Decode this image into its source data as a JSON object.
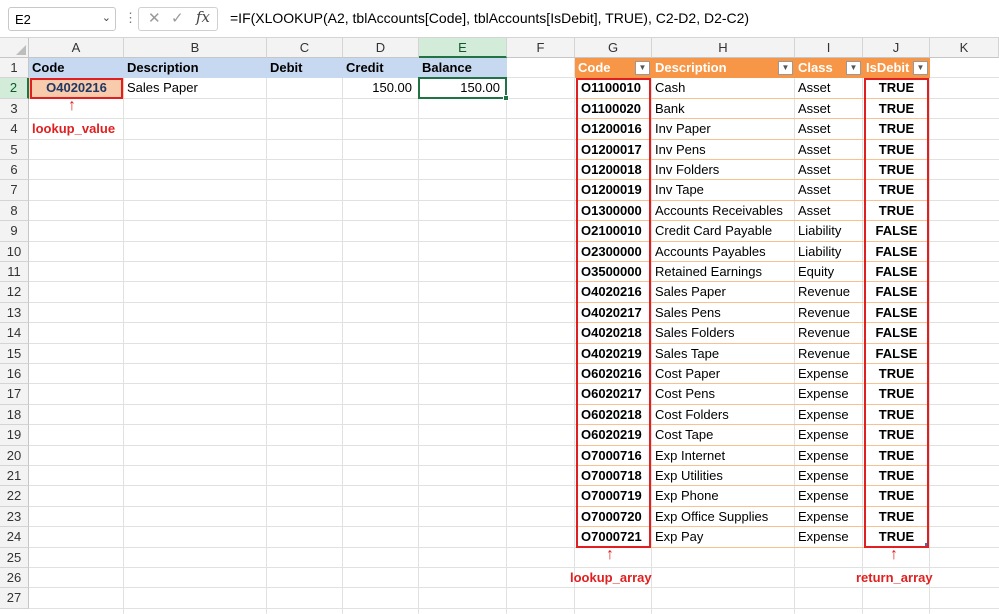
{
  "formula_bar": {
    "name_box": "E2",
    "formula": "=IF(XLOOKUP(A2, tblAccounts[Code], tblAccounts[IsDebit], TRUE), C2-D2, D2-C2)"
  },
  "columns": [
    "A",
    "B",
    "C",
    "D",
    "E",
    "F",
    "G",
    "H",
    "I",
    "J",
    "K"
  ],
  "rows": [
    "1",
    "2",
    "3",
    "4",
    "5",
    "6",
    "7",
    "8",
    "9",
    "10",
    "11",
    "12",
    "13",
    "14",
    "15",
    "16",
    "17",
    "18",
    "19",
    "20",
    "21",
    "22",
    "23",
    "24",
    "25",
    "26",
    "27"
  ],
  "left_table": {
    "headers": {
      "code": "Code",
      "description": "Description",
      "debit": "Debit",
      "credit": "Credit",
      "balance": "Balance"
    },
    "row2": {
      "code": "O4020216",
      "description": "Sales Paper",
      "debit": "",
      "credit": "150.00",
      "balance": "150.00"
    }
  },
  "accounts_table": {
    "headers": {
      "code": "Code",
      "description": "Description",
      "class": "Class",
      "isdebit": "IsDebit"
    },
    "rows": [
      {
        "code": "O1100010",
        "description": "Cash",
        "class": "Asset",
        "isdebit": "TRUE"
      },
      {
        "code": "O1100020",
        "description": "Bank",
        "class": "Asset",
        "isdebit": "TRUE"
      },
      {
        "code": "O1200016",
        "description": "Inv Paper",
        "class": "Asset",
        "isdebit": "TRUE"
      },
      {
        "code": "O1200017",
        "description": "Inv Pens",
        "class": "Asset",
        "isdebit": "TRUE"
      },
      {
        "code": "O1200018",
        "description": "Inv Folders",
        "class": "Asset",
        "isdebit": "TRUE"
      },
      {
        "code": "O1200019",
        "description": "Inv Tape",
        "class": "Asset",
        "isdebit": "TRUE"
      },
      {
        "code": "O1300000",
        "description": "Accounts Receivables",
        "class": "Asset",
        "isdebit": "TRUE"
      },
      {
        "code": "O2100010",
        "description": "Credit Card Payable",
        "class": "Liability",
        "isdebit": "FALSE"
      },
      {
        "code": "O2300000",
        "description": "Accounts Payables",
        "class": "Liability",
        "isdebit": "FALSE"
      },
      {
        "code": "O3500000",
        "description": "Retained Earnings",
        "class": "Equity",
        "isdebit": "FALSE"
      },
      {
        "code": "O4020216",
        "description": "Sales Paper",
        "class": "Revenue",
        "isdebit": "FALSE"
      },
      {
        "code": "O4020217",
        "description": "Sales Pens",
        "class": "Revenue",
        "isdebit": "FALSE"
      },
      {
        "code": "O4020218",
        "description": "Sales Folders",
        "class": "Revenue",
        "isdebit": "FALSE"
      },
      {
        "code": "O4020219",
        "description": "Sales Tape",
        "class": "Revenue",
        "isdebit": "FALSE"
      },
      {
        "code": "O6020216",
        "description": "Cost Paper",
        "class": "Expense",
        "isdebit": "TRUE"
      },
      {
        "code": "O6020217",
        "description": "Cost Pens",
        "class": "Expense",
        "isdebit": "TRUE"
      },
      {
        "code": "O6020218",
        "description": "Cost Folders",
        "class": "Expense",
        "isdebit": "TRUE"
      },
      {
        "code": "O6020219",
        "description": "Cost Tape",
        "class": "Expense",
        "isdebit": "TRUE"
      },
      {
        "code": "O7000716",
        "description": "Exp Internet",
        "class": "Expense",
        "isdebit": "TRUE"
      },
      {
        "code": "O7000718",
        "description": "Exp Utilities",
        "class": "Expense",
        "isdebit": "TRUE"
      },
      {
        "code": "O7000719",
        "description": "Exp Phone",
        "class": "Expense",
        "isdebit": "TRUE"
      },
      {
        "code": "O7000720",
        "description": "Exp Office Supplies",
        "class": "Expense",
        "isdebit": "TRUE"
      },
      {
        "code": "O7000721",
        "description": "Exp Pay",
        "class": "Expense",
        "isdebit": "TRUE"
      }
    ]
  },
  "annotations": {
    "lookup_value": "lookup_value",
    "lookup_array": "lookup_array",
    "return_array": "return_array",
    "arrow": "↑"
  },
  "colors": {
    "annotation": "#e02020",
    "table_header": "#f79646",
    "left_header": "#c7d9f1",
    "lookup_cell": "#f8cbad",
    "active_cell": "#217346"
  }
}
